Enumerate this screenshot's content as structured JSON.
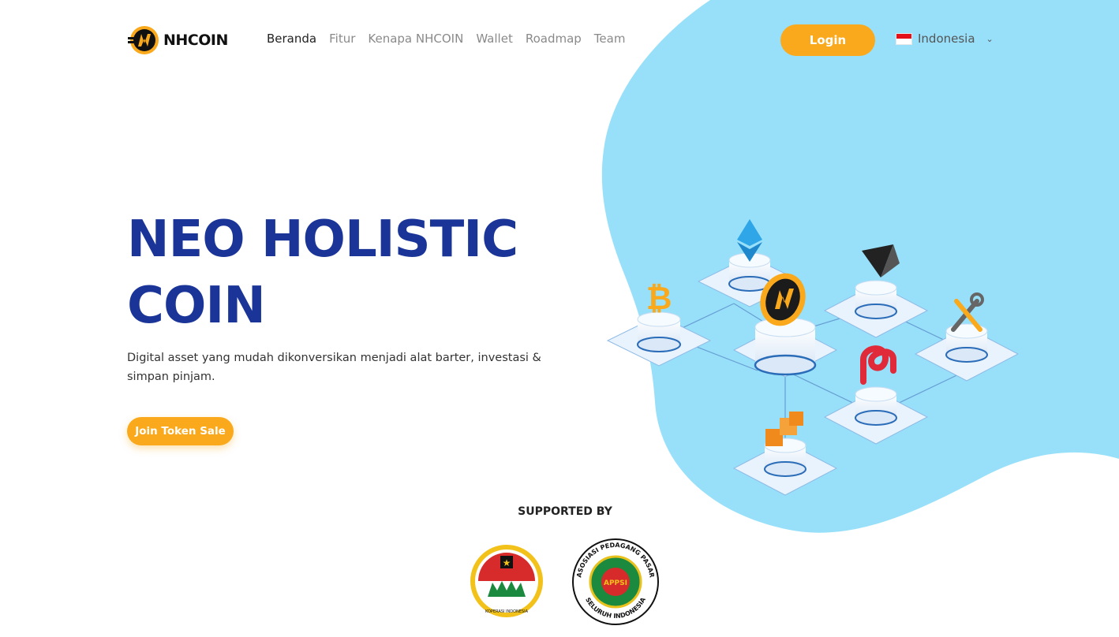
{
  "brand": {
    "name": "NHCOIN"
  },
  "nav": {
    "items": [
      {
        "label": "Beranda",
        "active": true
      },
      {
        "label": "Fitur",
        "active": false
      },
      {
        "label": "Kenapa NHCOIN",
        "active": false
      },
      {
        "label": "Wallet",
        "active": false
      },
      {
        "label": "Roadmap",
        "active": false
      },
      {
        "label": "Team",
        "active": false
      }
    ]
  },
  "header": {
    "login_label": "Login",
    "language": "Indonesia"
  },
  "hero": {
    "title_line1": "NEO HOLISTIC",
    "title_line2": "COIN",
    "subtitle": "Digital asset yang mudah dikonversikan menjadi alat barter, investasi & simpan pinjam.",
    "cta_label": "Join Token Sale"
  },
  "supported": {
    "heading": "SUPPORTED BY",
    "logos": [
      {
        "icon": "koperasi-indonesia-logo",
        "text": "KOPERASI INDONESIA"
      },
      {
        "icon": "appsi-logo",
        "text": "ASOSIASI PEDAGANG PASAR SELURUH INDONESIA",
        "center": "APPSI"
      }
    ]
  },
  "colors": {
    "accent": "#f9a91b",
    "title": "#1a3597",
    "blob": "#98e0fa"
  }
}
